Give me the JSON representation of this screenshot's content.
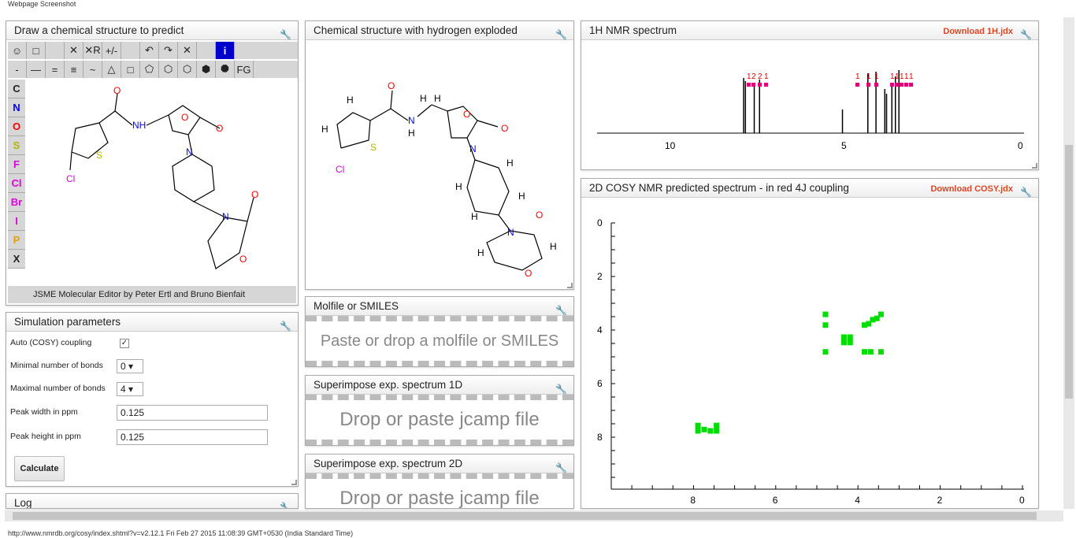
{
  "caption": "Webpage Screenshot",
  "status_url": "http://www.nmrdb.org/cosy/index.shtml?v=v2.12.1 Fri Feb 27 2015 11:08:39 GMT+0530 (India Standard Time)",
  "draw": {
    "title": "Draw a chemical structure to predict",
    "footer": "JSME Molecular Editor by Peter Ertl and Bruno Bienfait",
    "toolbar_top": [
      "☺",
      "□",
      "",
      "✕",
      "✕R",
      "+/-",
      "",
      "↶",
      "↷",
      "✕",
      "",
      "i"
    ],
    "toolbar_bonds": [
      "-",
      "—",
      "=",
      "≡",
      "~",
      "△",
      "□",
      "⬠",
      "⬡",
      "⬡",
      "⬢",
      "⯃",
      "FG"
    ],
    "atoms": [
      "C",
      "N",
      "O",
      "S",
      "F",
      "Cl",
      "Br",
      "I",
      "P",
      "X"
    ],
    "atom_colors": [
      "#222",
      "#0000ff",
      "#ff0000",
      "#b3b300",
      "#e000e0",
      "#e000e0",
      "#e000e0",
      "#e000e0",
      "#e8a000",
      "#222"
    ]
  },
  "params": {
    "title": "Simulation parameters",
    "auto_label": "Auto (COSY) coupling",
    "min_label": "Minimal number of bonds",
    "min_value": "0",
    "max_label": "Maximal number of bonds",
    "max_value": "4",
    "width_label": "Peak width in ppm",
    "width_value": "0.125",
    "height_label": "Peak height in ppm",
    "height_value": "0.125",
    "calc": "Calculate"
  },
  "log_title": "Log",
  "exploded_title": "Chemical structure with hydrogen exploded",
  "molfile": {
    "title": "Molfile or SMILES",
    "placeholder": "Paste or drop a molfile or SMILES"
  },
  "sup1d": {
    "title": "Superimpose exp. spectrum 1D",
    "placeholder": "Drop or paste jcamp file"
  },
  "sup2d": {
    "title": "Superimpose exp. spectrum 2D",
    "placeholder": "Drop or paste jcamp file"
  },
  "h1": {
    "title": "1H NMR spectrum",
    "download": "Download 1H.jdx",
    "ticks": [
      "10",
      "5",
      "0"
    ],
    "labels": [
      "1",
      "2",
      "2",
      "1",
      "1",
      "1",
      "1",
      "1",
      "1",
      "1",
      "1",
      "1"
    ]
  },
  "cosy": {
    "title": "2D COSY NMR predicted spectrum - in red 4J coupling",
    "download": "Download COSY.jdx",
    "xticks": [
      "8",
      "6",
      "4",
      "2",
      "0"
    ],
    "yticks": [
      "0",
      "2",
      "4",
      "6",
      "8"
    ]
  },
  "icons": {
    "wrench": "wrench-icon"
  }
}
